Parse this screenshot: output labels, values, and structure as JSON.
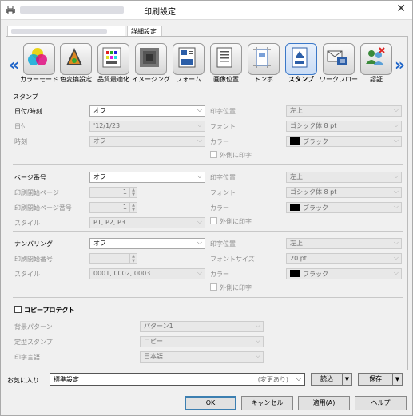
{
  "window": {
    "title": "印刷設定",
    "close_glyph": "✕"
  },
  "tabs": [
    {
      "label": "詳細設定"
    }
  ],
  "toolbar": {
    "left_arrow": "«",
    "right_arrow": "»",
    "items": [
      {
        "label": "カラーモード"
      },
      {
        "label": "色変換設定"
      },
      {
        "label": "品質最適化"
      },
      {
        "label": "イメージング"
      },
      {
        "label": "フォーム"
      },
      {
        "label": "画像位置"
      },
      {
        "label": "トンボ"
      },
      {
        "label": "スタンプ"
      },
      {
        "label": "ワークフロー"
      },
      {
        "label": "認証"
      }
    ]
  },
  "stamp": {
    "section_title": "スタンプ",
    "date": {
      "label": "日付/時刻",
      "value": "オフ",
      "date_label": "日付",
      "date_value": "'12/1/23",
      "time_label": "時刻",
      "time_value": "オフ",
      "pos_label": "印字位置",
      "pos_value": "左上",
      "font_label": "フォント",
      "font_value": "ゴシック体 8 pt",
      "color_label": "カラー",
      "color_value": "ブラック",
      "outside_label": "外側に印字"
    },
    "page": {
      "label": "ページ番号",
      "value": "オフ",
      "start_label": "印刷開始ページ",
      "start_value": "1",
      "startnum_label": "印刷開始ページ番号",
      "startnum_value": "1",
      "style_label": "スタイル",
      "style_value": "P1, P2, P3...",
      "pos_label": "印字位置",
      "pos_value": "左上",
      "font_label": "フォント",
      "font_value": "ゴシック体 8 pt",
      "color_label": "カラー",
      "color_value": "ブラック",
      "outside_label": "外側に印字"
    },
    "numbering": {
      "label": "ナンバリング",
      "value": "オフ",
      "start_label": "印刷開始番号",
      "start_value": "1",
      "style_label": "スタイル",
      "style_value": "0001, 0002, 0003...",
      "pos_label": "印字位置",
      "pos_value": "左上",
      "fontsize_label": "フォントサイズ",
      "fontsize_value": "20 pt",
      "color_label": "カラー",
      "color_value": "ブラック",
      "outside_label": "外側に印字"
    },
    "copyprotect": {
      "label": "コピープロテクト",
      "bg_label": "背景パターン",
      "bg_value": "パターン1",
      "fixed_label": "定型スタンプ",
      "fixed_value": "コピー",
      "lang_label": "印字言語",
      "lang_value": "日本語"
    }
  },
  "favorites": {
    "label": "お気に入り",
    "value": "標準設定",
    "changed": "(変更あり)",
    "load": "読込",
    "save": "保存"
  },
  "buttons": {
    "ok": "OK",
    "cancel": "キャンセル",
    "apply": "適用(A)",
    "help": "ヘルプ"
  },
  "colors": {
    "swatch": "#000000",
    "arrow": "#1e64c8",
    "active": "#3b78c8"
  }
}
